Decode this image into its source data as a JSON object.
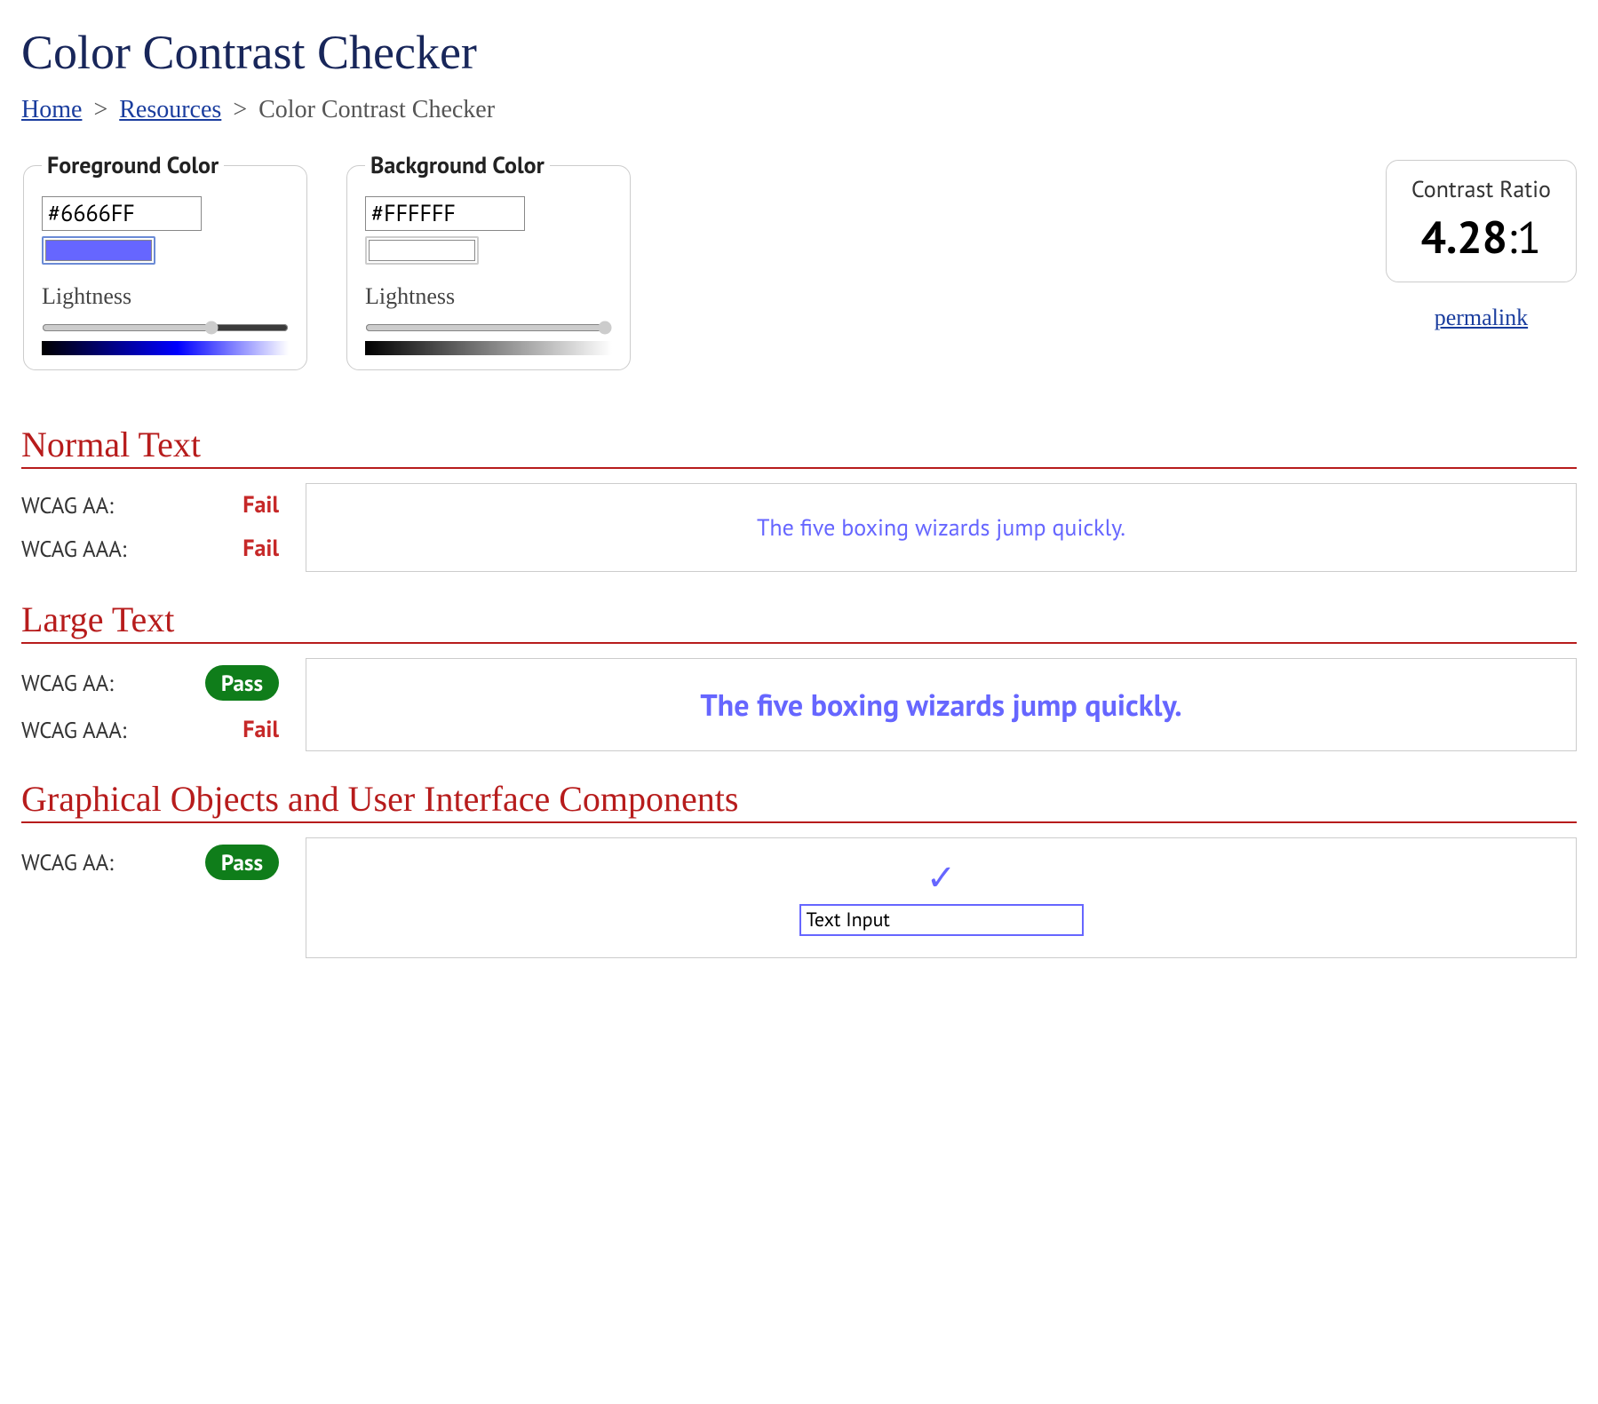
{
  "page": {
    "title": "Color Contrast Checker"
  },
  "breadcrumb": {
    "home": "Home",
    "resources": "Resources",
    "current": "Color Contrast Checker",
    "sep": ">"
  },
  "foreground": {
    "legend": "Foreground Color",
    "hex": "#6666FF",
    "swatch_color": "#6666FF",
    "lightness_label": "Lightness",
    "lightness_value": 70,
    "gradient_css": "linear-gradient(to right, #000000, #0000ff 55%, #ffffff)"
  },
  "background": {
    "legend": "Background Color",
    "hex": "#FFFFFF",
    "swatch_color": "#FFFFFF",
    "lightness_label": "Lightness",
    "lightness_value": 100,
    "gradient_css": "linear-gradient(to right, #000000, #ffffff)"
  },
  "ratio": {
    "label": "Contrast Ratio",
    "value": "4.28",
    "suffix": ":1",
    "permalink": "permalink"
  },
  "sections": {
    "normal": {
      "heading": "Normal Text",
      "aa_label": "WCAG AA:",
      "aa_result": "Fail",
      "aa_pass": false,
      "aaa_label": "WCAG AAA:",
      "aaa_result": "Fail",
      "aaa_pass": false,
      "sample": "The five boxing wizards jump quickly."
    },
    "large": {
      "heading": "Large Text",
      "aa_label": "WCAG AA:",
      "aa_result": "Pass",
      "aa_pass": true,
      "aaa_label": "WCAG AAA:",
      "aaa_result": "Fail",
      "aaa_pass": false,
      "sample": "The five boxing wizards jump quickly."
    },
    "ui": {
      "heading": "Graphical Objects and User Interface Components",
      "aa_label": "WCAG AA:",
      "aa_result": "Pass",
      "aa_pass": true,
      "check_glyph": "✓",
      "input_value": "Text Input"
    }
  }
}
